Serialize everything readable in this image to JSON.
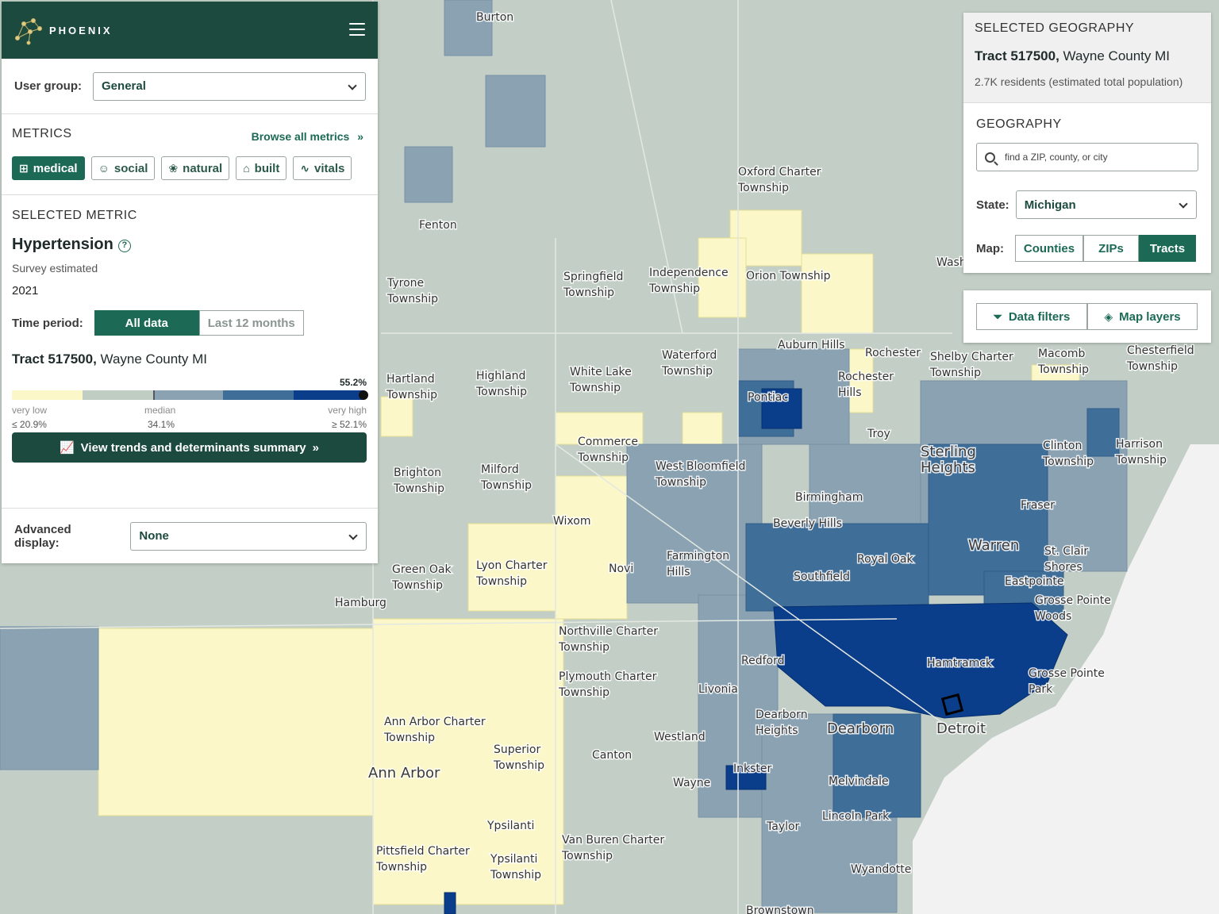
{
  "brand": {
    "name": "PHOENIX"
  },
  "user_group": {
    "label": "User group:",
    "value": "General"
  },
  "metrics": {
    "title": "METRICS",
    "browse_label": "Browse all metrics",
    "chips": [
      {
        "label": "medical",
        "icon": "medical-kit-icon",
        "active": true
      },
      {
        "label": "social",
        "icon": "social-icon",
        "active": false
      },
      {
        "label": "natural",
        "icon": "natural-icon",
        "active": false
      },
      {
        "label": "built",
        "icon": "building-icon",
        "active": false
      },
      {
        "label": "vitals",
        "icon": "pulse-icon",
        "active": false
      }
    ]
  },
  "selected_metric": {
    "title": "SELECTED METRIC",
    "name": "Hypertension",
    "source": "Survey estimated",
    "year": "2021",
    "time_period_label": "Time period:",
    "time_options": [
      "All data",
      "Last 12 months"
    ],
    "time_active": "All data",
    "tract_bold": "Tract 517500,",
    "tract_rest": " Wayne County MI",
    "value_label": "55.2%",
    "legend": {
      "colors": [
        "#fbf7c8",
        "#bfcdc2",
        "#8aa2b2",
        "#3f6e99",
        "#0a3d8a"
      ],
      "low_label": "very low",
      "low_value": "≤ 20.9%",
      "median_label": "median",
      "median_value": "34.1%",
      "high_label": "very high",
      "high_value": "≥ 52.1%",
      "marker_fraction": 1.0
    },
    "trends_button": "View trends and determinants summary"
  },
  "advanced_display": {
    "label": "Advanced display:",
    "value": "None"
  },
  "selected_geography": {
    "title": "SELECTED GEOGRAPHY",
    "tract_bold": "Tract 517500,",
    "tract_rest": " Wayne County MI",
    "population": "2.7K residents (estimated total population)"
  },
  "geography": {
    "title": "GEOGRAPHY",
    "search_placeholder": "find a ZIP, county, or city",
    "state_label": "State:",
    "state_value": "Michigan",
    "map_label": "Map:",
    "map_options": [
      "Counties",
      "ZIPs",
      "Tracts"
    ],
    "map_active": "Tracts"
  },
  "filters": {
    "data_filters": "Data filters",
    "map_layers": "Map layers"
  },
  "map_labels": [
    "Burton",
    "Fenton",
    "Oxford Charter Township",
    "Tyrone Township",
    "Springfield Township",
    "Independence Township",
    "Orion Township",
    "Auburn Hills",
    "Rochester",
    "Rochester Hills",
    "Shelby Charter Township",
    "Macomb Township",
    "Chesterfield Township",
    "Hartland Township",
    "Highland Township",
    "White Lake Township",
    "Waterford Township",
    "Pontiac",
    "Troy",
    "Sterling Heights",
    "Clinton Township",
    "Harrison Township",
    "Commerce Township",
    "West Bloomfield Township",
    "Brighton Township",
    "Milford Township",
    "Birmingham",
    "Fraser",
    "Wixom",
    "Beverly Hills",
    "Warren",
    "St. Clair Shores",
    "Farmington Hills",
    "Novi",
    "Royal Oak",
    "Southfield",
    "Eastpointe",
    "Green Oak Township",
    "Lyon Charter Township",
    "Hamburg",
    "Grosse Pointe Woods",
    "Northville Charter Township",
    "Redford",
    "Hamtramck",
    "Plymouth Charter Township",
    "Livonia",
    "Grosse Pointe Park",
    "Dearborn Heights",
    "Dearborn",
    "Detroit",
    "Ann Arbor Charter Township",
    "Westland",
    "Superior Township",
    "Canton",
    "Ann Arbor",
    "Inkster",
    "Wayne",
    "Melvindale",
    "Lincoln Park",
    "Ypsilanti",
    "Taylor",
    "Van Buren Charter Township",
    "Pittsfield Charter Township",
    "Ypsilanti Township",
    "Wyandotte",
    "Brownstown",
    "Wash Township"
  ]
}
